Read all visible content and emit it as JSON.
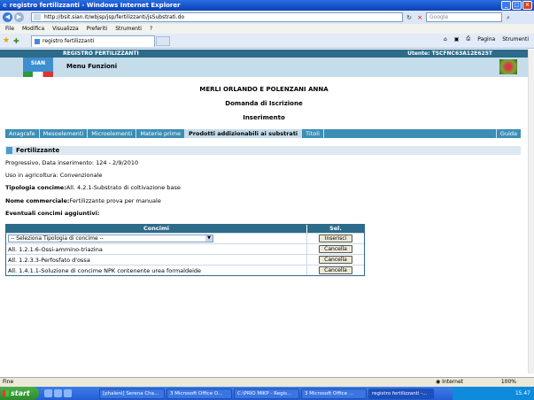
{
  "window": {
    "title": "registro fertilizzanti - Windows Internet Explorer",
    "url": "http://bsit.sian.it/wbjsp/jsp/fertilizzanti/jsSubstrati.do",
    "search_placeholder": "Google"
  },
  "menu": [
    "File",
    "Modifica",
    "Visualizza",
    "Preferiti",
    "Strumenti",
    "?"
  ],
  "tab": {
    "label": "registro fertilizzanti"
  },
  "commands": {
    "pagina": "Pagina",
    "strumenti": "Strumenti"
  },
  "header": {
    "registry_title": "REGISTRO FERTILIZZANTI",
    "user": "Utente: TSCFNC63A12E625T",
    "logo_text": "SIAN",
    "menu_title": "Menu Funzioni"
  },
  "page": {
    "company": "MERLI ORLANDO E POLENZANI ANNA",
    "subtitle": "Domanda di Iscrizione",
    "mode": "Inserimento"
  },
  "nav_tabs": [
    "Anagrafe",
    "Mesoelementi",
    "Microelementi",
    "Materie prime",
    "Prodotti addizionabili ai substrati",
    "Titoli",
    "Guida"
  ],
  "section": {
    "title": "Fertilizzante",
    "progressivo": "Progressivo, Data inserimento: 124 - 2/9/2010",
    "uso": "Uso in agricoltura: Convenzionale",
    "tipologia_label": "Tipologia concime:",
    "tipologia_value": "All. 4.2.1-Substrato di coltivazione base",
    "nome_label": "Nome commerciale:",
    "nome_value": "Fertilizzante prova per manuale",
    "eventuali": "Eventuali concimi aggiuntivi:"
  },
  "table": {
    "col_concimi": "Concimi",
    "col_sel": "Sel.",
    "select_value": "-- Seleziona Tipologia di concime --",
    "insert_label": "Inserisci",
    "rows": [
      {
        "text": "All. 1.2.1.6-Ossi-ammino-triazina",
        "action": "Cancella"
      },
      {
        "text": "All. 1.2.3.3-Perfosfato d'ossa",
        "action": "Cancella"
      },
      {
        "text": "All. 1.4.1.1-Soluzione di concime NPK contenente urea formaldeide",
        "action": "Cancella"
      }
    ]
  },
  "status": {
    "left": "Fine",
    "zone": "Internet",
    "zoom": "100%"
  },
  "taskbar": {
    "start": "start",
    "items": [
      "[phaleni] Serena Cha...",
      "3 Microsoft Office O...",
      "C:\\PRIO MIKP - Regis...",
      "3 Microsoft Office ...",
      "registro fertilizzanti -..."
    ],
    "clock": "15.47"
  }
}
